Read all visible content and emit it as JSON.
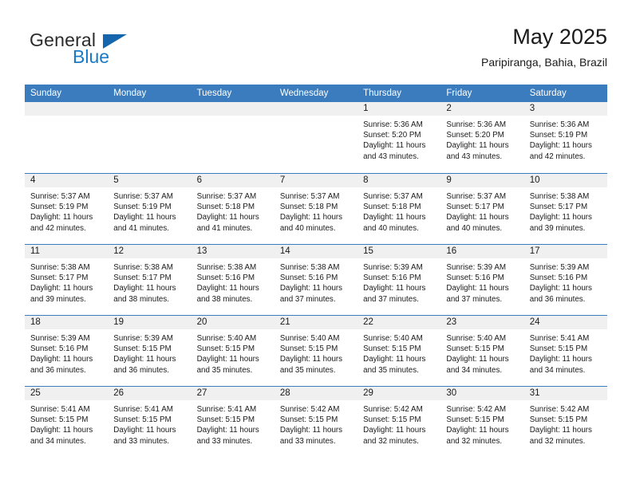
{
  "brand": {
    "name_top": "General",
    "name_bottom": "Blue",
    "triangle_icon": "blue-triangle-logo-mark",
    "color_top": "#2b2b2b",
    "color_bottom": "#1a7ac7"
  },
  "header": {
    "title": "May 2025",
    "subtitle": "Paripiranga, Bahia, Brazil"
  },
  "theme": {
    "header_blue": "#3a7cbd",
    "daynum_band": "#f0f0f0",
    "text": "#1a1a1a"
  },
  "weekdays": [
    "Sunday",
    "Monday",
    "Tuesday",
    "Wednesday",
    "Thursday",
    "Friday",
    "Saturday"
  ],
  "weeks": [
    [
      {
        "day": "",
        "empty": true
      },
      {
        "day": "",
        "empty": true
      },
      {
        "day": "",
        "empty": true
      },
      {
        "day": "",
        "empty": true
      },
      {
        "day": "1",
        "sunrise": "Sunrise: 5:36 AM",
        "sunset": "Sunset: 5:20 PM",
        "daylight1": "Daylight: 11 hours",
        "daylight2": "and 43 minutes."
      },
      {
        "day": "2",
        "sunrise": "Sunrise: 5:36 AM",
        "sunset": "Sunset: 5:20 PM",
        "daylight1": "Daylight: 11 hours",
        "daylight2": "and 43 minutes."
      },
      {
        "day": "3",
        "sunrise": "Sunrise: 5:36 AM",
        "sunset": "Sunset: 5:19 PM",
        "daylight1": "Daylight: 11 hours",
        "daylight2": "and 42 minutes."
      }
    ],
    [
      {
        "day": "4",
        "sunrise": "Sunrise: 5:37 AM",
        "sunset": "Sunset: 5:19 PM",
        "daylight1": "Daylight: 11 hours",
        "daylight2": "and 42 minutes."
      },
      {
        "day": "5",
        "sunrise": "Sunrise: 5:37 AM",
        "sunset": "Sunset: 5:19 PM",
        "daylight1": "Daylight: 11 hours",
        "daylight2": "and 41 minutes."
      },
      {
        "day": "6",
        "sunrise": "Sunrise: 5:37 AM",
        "sunset": "Sunset: 5:18 PM",
        "daylight1": "Daylight: 11 hours",
        "daylight2": "and 41 minutes."
      },
      {
        "day": "7",
        "sunrise": "Sunrise: 5:37 AM",
        "sunset": "Sunset: 5:18 PM",
        "daylight1": "Daylight: 11 hours",
        "daylight2": "and 40 minutes."
      },
      {
        "day": "8",
        "sunrise": "Sunrise: 5:37 AM",
        "sunset": "Sunset: 5:18 PM",
        "daylight1": "Daylight: 11 hours",
        "daylight2": "and 40 minutes."
      },
      {
        "day": "9",
        "sunrise": "Sunrise: 5:37 AM",
        "sunset": "Sunset: 5:17 PM",
        "daylight1": "Daylight: 11 hours",
        "daylight2": "and 40 minutes."
      },
      {
        "day": "10",
        "sunrise": "Sunrise: 5:38 AM",
        "sunset": "Sunset: 5:17 PM",
        "daylight1": "Daylight: 11 hours",
        "daylight2": "and 39 minutes."
      }
    ],
    [
      {
        "day": "11",
        "sunrise": "Sunrise: 5:38 AM",
        "sunset": "Sunset: 5:17 PM",
        "daylight1": "Daylight: 11 hours",
        "daylight2": "and 39 minutes."
      },
      {
        "day": "12",
        "sunrise": "Sunrise: 5:38 AM",
        "sunset": "Sunset: 5:17 PM",
        "daylight1": "Daylight: 11 hours",
        "daylight2": "and 38 minutes."
      },
      {
        "day": "13",
        "sunrise": "Sunrise: 5:38 AM",
        "sunset": "Sunset: 5:16 PM",
        "daylight1": "Daylight: 11 hours",
        "daylight2": "and 38 minutes."
      },
      {
        "day": "14",
        "sunrise": "Sunrise: 5:38 AM",
        "sunset": "Sunset: 5:16 PM",
        "daylight1": "Daylight: 11 hours",
        "daylight2": "and 37 minutes."
      },
      {
        "day": "15",
        "sunrise": "Sunrise: 5:39 AM",
        "sunset": "Sunset: 5:16 PM",
        "daylight1": "Daylight: 11 hours",
        "daylight2": "and 37 minutes."
      },
      {
        "day": "16",
        "sunrise": "Sunrise: 5:39 AM",
        "sunset": "Sunset: 5:16 PM",
        "daylight1": "Daylight: 11 hours",
        "daylight2": "and 37 minutes."
      },
      {
        "day": "17",
        "sunrise": "Sunrise: 5:39 AM",
        "sunset": "Sunset: 5:16 PM",
        "daylight1": "Daylight: 11 hours",
        "daylight2": "and 36 minutes."
      }
    ],
    [
      {
        "day": "18",
        "sunrise": "Sunrise: 5:39 AM",
        "sunset": "Sunset: 5:16 PM",
        "daylight1": "Daylight: 11 hours",
        "daylight2": "and 36 minutes."
      },
      {
        "day": "19",
        "sunrise": "Sunrise: 5:39 AM",
        "sunset": "Sunset: 5:15 PM",
        "daylight1": "Daylight: 11 hours",
        "daylight2": "and 36 minutes."
      },
      {
        "day": "20",
        "sunrise": "Sunrise: 5:40 AM",
        "sunset": "Sunset: 5:15 PM",
        "daylight1": "Daylight: 11 hours",
        "daylight2": "and 35 minutes."
      },
      {
        "day": "21",
        "sunrise": "Sunrise: 5:40 AM",
        "sunset": "Sunset: 5:15 PM",
        "daylight1": "Daylight: 11 hours",
        "daylight2": "and 35 minutes."
      },
      {
        "day": "22",
        "sunrise": "Sunrise: 5:40 AM",
        "sunset": "Sunset: 5:15 PM",
        "daylight1": "Daylight: 11 hours",
        "daylight2": "and 35 minutes."
      },
      {
        "day": "23",
        "sunrise": "Sunrise: 5:40 AM",
        "sunset": "Sunset: 5:15 PM",
        "daylight1": "Daylight: 11 hours",
        "daylight2": "and 34 minutes."
      },
      {
        "day": "24",
        "sunrise": "Sunrise: 5:41 AM",
        "sunset": "Sunset: 5:15 PM",
        "daylight1": "Daylight: 11 hours",
        "daylight2": "and 34 minutes."
      }
    ],
    [
      {
        "day": "25",
        "sunrise": "Sunrise: 5:41 AM",
        "sunset": "Sunset: 5:15 PM",
        "daylight1": "Daylight: 11 hours",
        "daylight2": "and 34 minutes."
      },
      {
        "day": "26",
        "sunrise": "Sunrise: 5:41 AM",
        "sunset": "Sunset: 5:15 PM",
        "daylight1": "Daylight: 11 hours",
        "daylight2": "and 33 minutes."
      },
      {
        "day": "27",
        "sunrise": "Sunrise: 5:41 AM",
        "sunset": "Sunset: 5:15 PM",
        "daylight1": "Daylight: 11 hours",
        "daylight2": "and 33 minutes."
      },
      {
        "day": "28",
        "sunrise": "Sunrise: 5:42 AM",
        "sunset": "Sunset: 5:15 PM",
        "daylight1": "Daylight: 11 hours",
        "daylight2": "and 33 minutes."
      },
      {
        "day": "29",
        "sunrise": "Sunrise: 5:42 AM",
        "sunset": "Sunset: 5:15 PM",
        "daylight1": "Daylight: 11 hours",
        "daylight2": "and 32 minutes."
      },
      {
        "day": "30",
        "sunrise": "Sunrise: 5:42 AM",
        "sunset": "Sunset: 5:15 PM",
        "daylight1": "Daylight: 11 hours",
        "daylight2": "and 32 minutes."
      },
      {
        "day": "31",
        "sunrise": "Sunrise: 5:42 AM",
        "sunset": "Sunset: 5:15 PM",
        "daylight1": "Daylight: 11 hours",
        "daylight2": "and 32 minutes."
      }
    ]
  ]
}
